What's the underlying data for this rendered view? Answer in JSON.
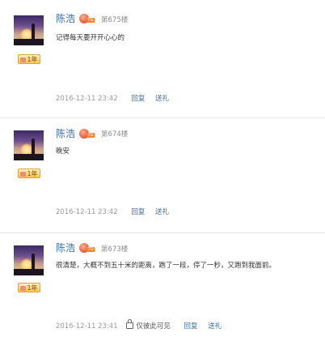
{
  "posts": [
    {
      "username": "陈浩",
      "level_icon": "tomato-level-icon",
      "floor": "第675楼",
      "year_badge": "1年",
      "content": "记得每天要开开心心的",
      "time": "2016-12-11 23:42",
      "reply": "回复",
      "gift": "送礼"
    },
    {
      "username": "陈浩",
      "level_icon": "tomato-level-icon",
      "floor": "第674楼",
      "year_badge": "1年",
      "content": "晚安",
      "time": "2016-12-11 23:42",
      "reply": "回复",
      "gift": "送礼"
    },
    {
      "username": "陈浩",
      "level_icon": "tomato-level-icon",
      "floor": "第673楼",
      "year_badge": "1年",
      "content": "很清楚，大概不到五十米的距离，跑了一段，停了一秒，又跑到我面前。",
      "time": "2016-12-11 23:41",
      "private": "仅彼此可见",
      "reply": "回复",
      "gift": "送礼"
    }
  ],
  "colors": {
    "link": "#3b6ea5",
    "meta": "#999999",
    "divider": "#e6e6e6"
  }
}
